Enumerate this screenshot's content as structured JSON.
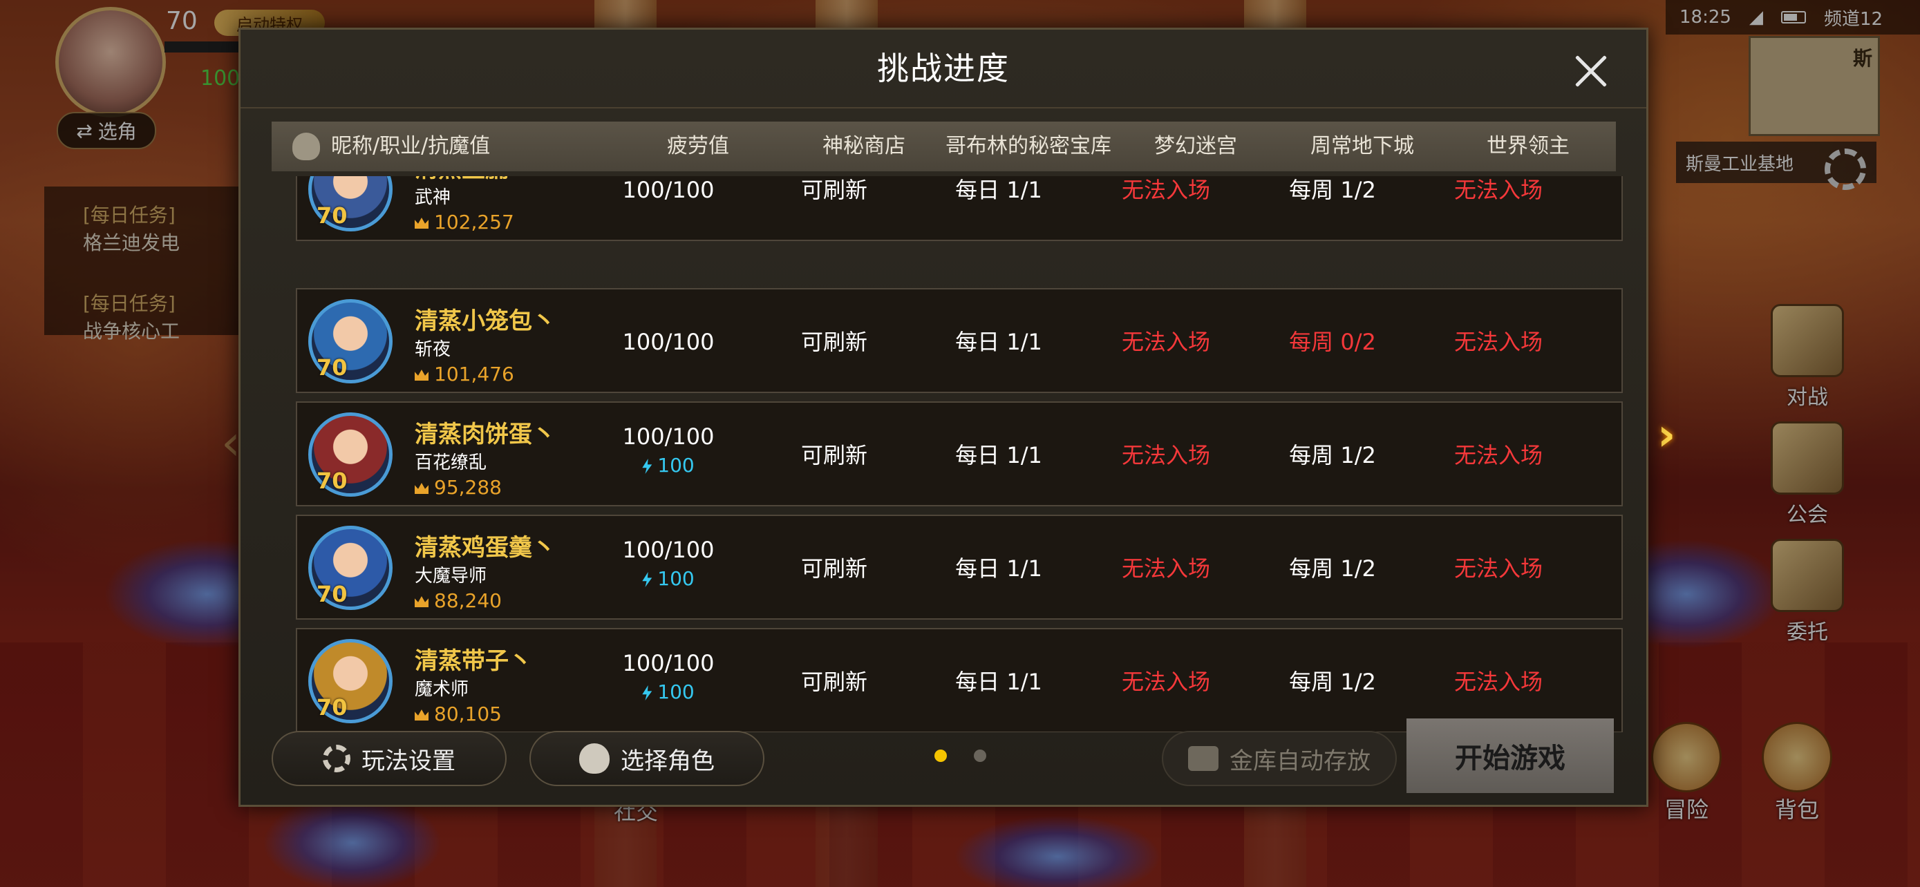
{
  "status_bar": {
    "time": "18:25",
    "channel": "频道12"
  },
  "player": {
    "level": "70",
    "event_tag": "启动特权",
    "green_value": "100",
    "select_role_label": "选角"
  },
  "map": {
    "corner_char": "斯",
    "location": "斯曼工业基地"
  },
  "quests": [
    {
      "tag": "[每日任务]",
      "text": "格兰迪发电"
    },
    {
      "tag": "[每日任务]",
      "text": "战争核心工"
    }
  ],
  "side_buttons": [
    {
      "label": "对战",
      "icon": "swords-icon"
    },
    {
      "label": "公会",
      "icon": "guild-icon"
    },
    {
      "label": "委托",
      "icon": "commission-icon"
    }
  ],
  "bottom_buttons": [
    {
      "label": "冒险",
      "icon": "adventure-icon"
    },
    {
      "label": "背包",
      "icon": "backpack-icon"
    },
    {
      "label": "社交",
      "icon": "social-icon"
    }
  ],
  "modal": {
    "title": "挑战进度",
    "headers": [
      "昵称/职业/抗魔值",
      "疲劳值",
      "神秘商店",
      "哥布林的秘密宝库",
      "梦幻迷宫",
      "周常地下城",
      "世界领主"
    ],
    "rows": [
      {
        "name": "清蒸里脯丶",
        "class": "武神",
        "level": "70",
        "power": "102,257",
        "fatigue": "100/100",
        "fatigue_bonus": null,
        "shop": "可刷新",
        "goblin": "每日 1/1",
        "maze": "无法入场",
        "weekly": "每周 1/2",
        "lord": "无法入场",
        "maze_red": true,
        "weekly_red": false,
        "lord_red": true
      },
      {
        "name": "清蒸小笼包丶",
        "class": "斩夜",
        "level": "70",
        "power": "101,476",
        "fatigue": "100/100",
        "fatigue_bonus": null,
        "shop": "可刷新",
        "goblin": "每日 1/1",
        "maze": "无法入场",
        "weekly": "每周 0/2",
        "lord": "无法入场",
        "maze_red": true,
        "weekly_red": true,
        "lord_red": true
      },
      {
        "name": "清蒸肉饼蛋丶",
        "class": "百花缭乱",
        "level": "70",
        "power": "95,288",
        "fatigue": "100/100",
        "fatigue_bonus": "100",
        "shop": "可刷新",
        "goblin": "每日 1/1",
        "maze": "无法入场",
        "weekly": "每周 1/2",
        "lord": "无法入场",
        "maze_red": true,
        "weekly_red": false,
        "lord_red": true
      },
      {
        "name": "清蒸鸡蛋羹丶",
        "class": "大魔导师",
        "level": "70",
        "power": "88,240",
        "fatigue": "100/100",
        "fatigue_bonus": "100",
        "shop": "可刷新",
        "goblin": "每日 1/1",
        "maze": "无法入场",
        "weekly": "每周 1/2",
        "lord": "无法入场",
        "maze_red": true,
        "weekly_red": false,
        "lord_red": true
      },
      {
        "name": "清蒸带子丶",
        "class": "魔术师",
        "level": "70",
        "power": "80,105",
        "fatigue": "100/100",
        "fatigue_bonus": "100",
        "shop": "可刷新",
        "goblin": "每日 1/1",
        "maze": "无法入场",
        "weekly": "每周 1/2",
        "lord": "无法入场",
        "maze_red": true,
        "weekly_red": false,
        "lord_red": true
      }
    ],
    "footer": {
      "settings_label": "玩法设置",
      "select_char_label": "选择角色",
      "vault_label": "金库自动存放",
      "start_label": "开始游戏",
      "page_current": 1,
      "page_total": 2
    }
  },
  "colors": {
    "accent_gold": "#f1c74a",
    "danger_red": "#f5383a",
    "fatigue_blue": "#35c8f0",
    "power_orange": "#e9a32a"
  }
}
